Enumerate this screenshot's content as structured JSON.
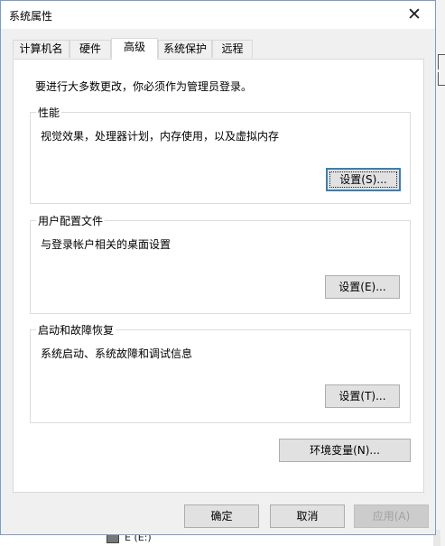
{
  "window": {
    "title": "系统属性",
    "close_glyph": "✕"
  },
  "tabs": [
    {
      "label": "计算机名"
    },
    {
      "label": "硬件"
    },
    {
      "label": "高级",
      "active": true
    },
    {
      "label": "系统保护"
    },
    {
      "label": "远程"
    }
  ],
  "panel": {
    "intro": "要进行大多数更改，你必须作为管理员登录。",
    "performance": {
      "title": "性能",
      "description": "视觉效果，处理器计划，内存使用，以及虚拟内存",
      "button": "设置(S)..."
    },
    "user_profiles": {
      "title": "用户配置文件",
      "description": "与登录帐户相关的桌面设置",
      "button": "设置(E)..."
    },
    "startup_recovery": {
      "title": "启动和故障恢复",
      "description": "系统启动、系统故障和调试信息",
      "button": "设置(T)..."
    },
    "env_button": "环境变量(N)..."
  },
  "footer": {
    "ok": "确定",
    "cancel": "取消",
    "apply": "应用(A)"
  },
  "background": {
    "drive_label": "E (E:)"
  },
  "colors": {
    "dialog_bg": "#f0f0f0",
    "panel_bg": "#ffffff",
    "default_button_border": "#3c7fb1",
    "disabled_text": "#a0a0a0"
  }
}
